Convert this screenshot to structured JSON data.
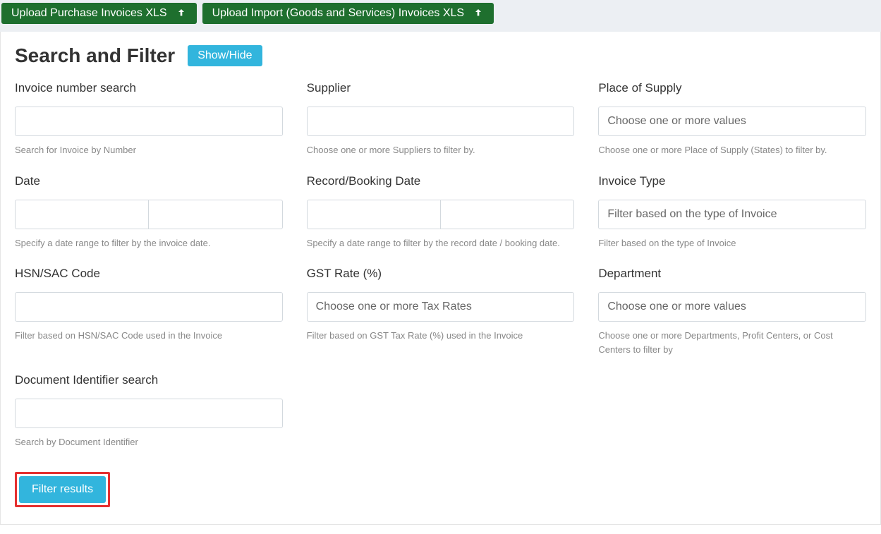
{
  "topbar": {
    "upload_purchase_label": "Upload Purchase Invoices XLS",
    "upload_import_label": "Upload Import (Goods and Services) Invoices XLS"
  },
  "panel": {
    "title": "Search and Filter",
    "show_hide_label": "Show/Hide",
    "filter_button_label": "Filter results"
  },
  "fields": {
    "invoice_number": {
      "label": "Invoice number search",
      "help": "Search for Invoice by Number"
    },
    "supplier": {
      "label": "Supplier",
      "help": "Choose one or more Suppliers to filter by."
    },
    "place_of_supply": {
      "label": "Place of Supply",
      "placeholder": "Choose one or more values",
      "help": "Choose one or more Place of Supply (States) to filter by."
    },
    "date": {
      "label": "Date",
      "help": "Specify a date range to filter by the invoice date."
    },
    "record_date": {
      "label": "Record/Booking Date",
      "help": "Specify a date range to filter by the record date / booking date."
    },
    "invoice_type": {
      "label": "Invoice Type",
      "placeholder": "Filter based on the type of Invoice",
      "help": "Filter based on the type of Invoice"
    },
    "hsn": {
      "label": "HSN/SAC Code",
      "help": "Filter based on HSN/SAC Code used in the Invoice"
    },
    "gst_rate": {
      "label": "GST Rate (%)",
      "placeholder": "Choose one or more Tax Rates",
      "help": "Filter based on GST Tax Rate (%) used in the Invoice"
    },
    "department": {
      "label": "Department",
      "placeholder": "Choose one or more values",
      "help": "Choose one or more Departments, Profit Centers, or Cost Centers to filter by"
    },
    "doc_id": {
      "label": "Document Identifier search",
      "help": "Search by Document Identifier"
    }
  }
}
